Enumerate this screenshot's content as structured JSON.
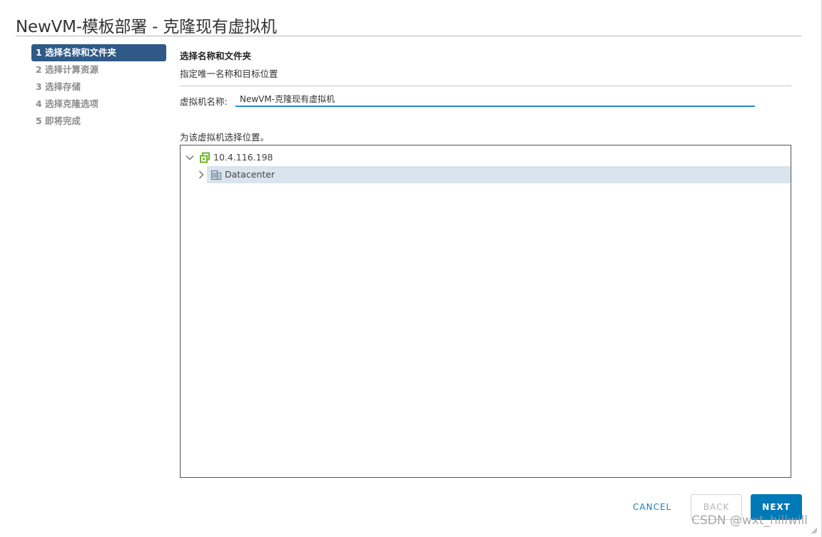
{
  "dialog": {
    "title": "NewVM-模板部署 - 克隆现有虚拟机"
  },
  "steps": [
    {
      "label": "1 选择名称和文件夹",
      "active": true
    },
    {
      "label": "2 选择计算资源",
      "active": false
    },
    {
      "label": "3 选择存储",
      "active": false
    },
    {
      "label": "4 选择克隆选项",
      "active": false
    },
    {
      "label": "5 即将完成",
      "active": false
    }
  ],
  "content": {
    "heading": "选择名称和文件夹",
    "subheading": "指定唯一名称和目标位置",
    "vm_name_label": "虚拟机名称:",
    "vm_name_value": "NewVM-克隆现有虚拟机",
    "location_label": "为该虚拟机选择位置。"
  },
  "tree": {
    "host": {
      "label": "10.4.116.198",
      "icon": "host-icon",
      "expanded": true
    },
    "datacenter": {
      "label": "Datacenter",
      "icon": "datacenter-icon",
      "expanded": false,
      "selected": true
    }
  },
  "footer": {
    "cancel_label": "CANCEL",
    "back_label": "BACK",
    "next_label": "NEXT"
  },
  "watermark": "CSDN @wxt_hillwill",
  "colors": {
    "active_step": "#2f5a87",
    "accent": "#0079b8",
    "input_underline": "#2a8ac9",
    "selected_row": "#d9e4ec",
    "host_icon": "#6fb52c"
  }
}
